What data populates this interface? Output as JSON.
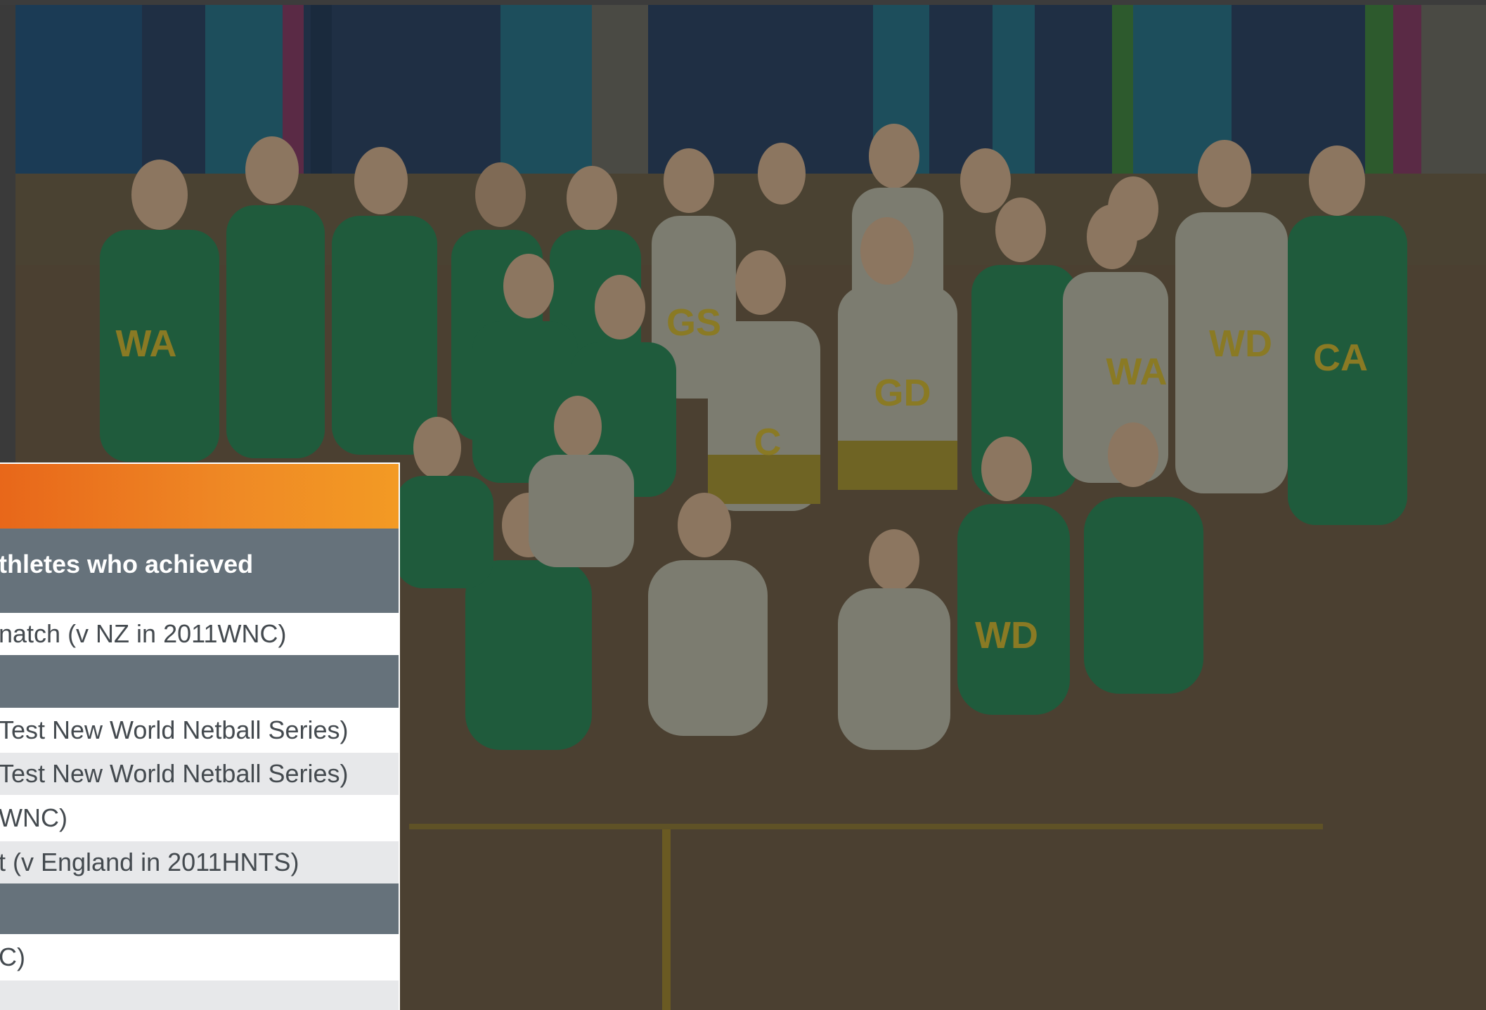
{
  "photo": {
    "alt_subject": "netball team group photo",
    "jersey_labels": [
      "WA",
      "GS",
      "C",
      "GD",
      "WA",
      "WD",
      "CA",
      "WD"
    ]
  },
  "panel": {
    "header_color": "#ef8a25",
    "section_color": "#66727b",
    "rows": [
      {
        "kind": "section",
        "text": "thletes who achieved"
      },
      {
        "kind": "white",
        "text": "natch (v NZ in 2011WNC)"
      },
      {
        "kind": "section",
        "text": ""
      },
      {
        "kind": "white",
        "text": "Test New World Netball Series)"
      },
      {
        "kind": "grey",
        "text": "Test New World Netball Series)"
      },
      {
        "kind": "white",
        "text": " WNC)"
      },
      {
        "kind": "grey",
        "text": "t (v England in 2011HNTS)"
      },
      {
        "kind": "section",
        "text": ""
      },
      {
        "kind": "white",
        "text": "C)"
      },
      {
        "kind": "grey",
        "text": ""
      }
    ]
  }
}
